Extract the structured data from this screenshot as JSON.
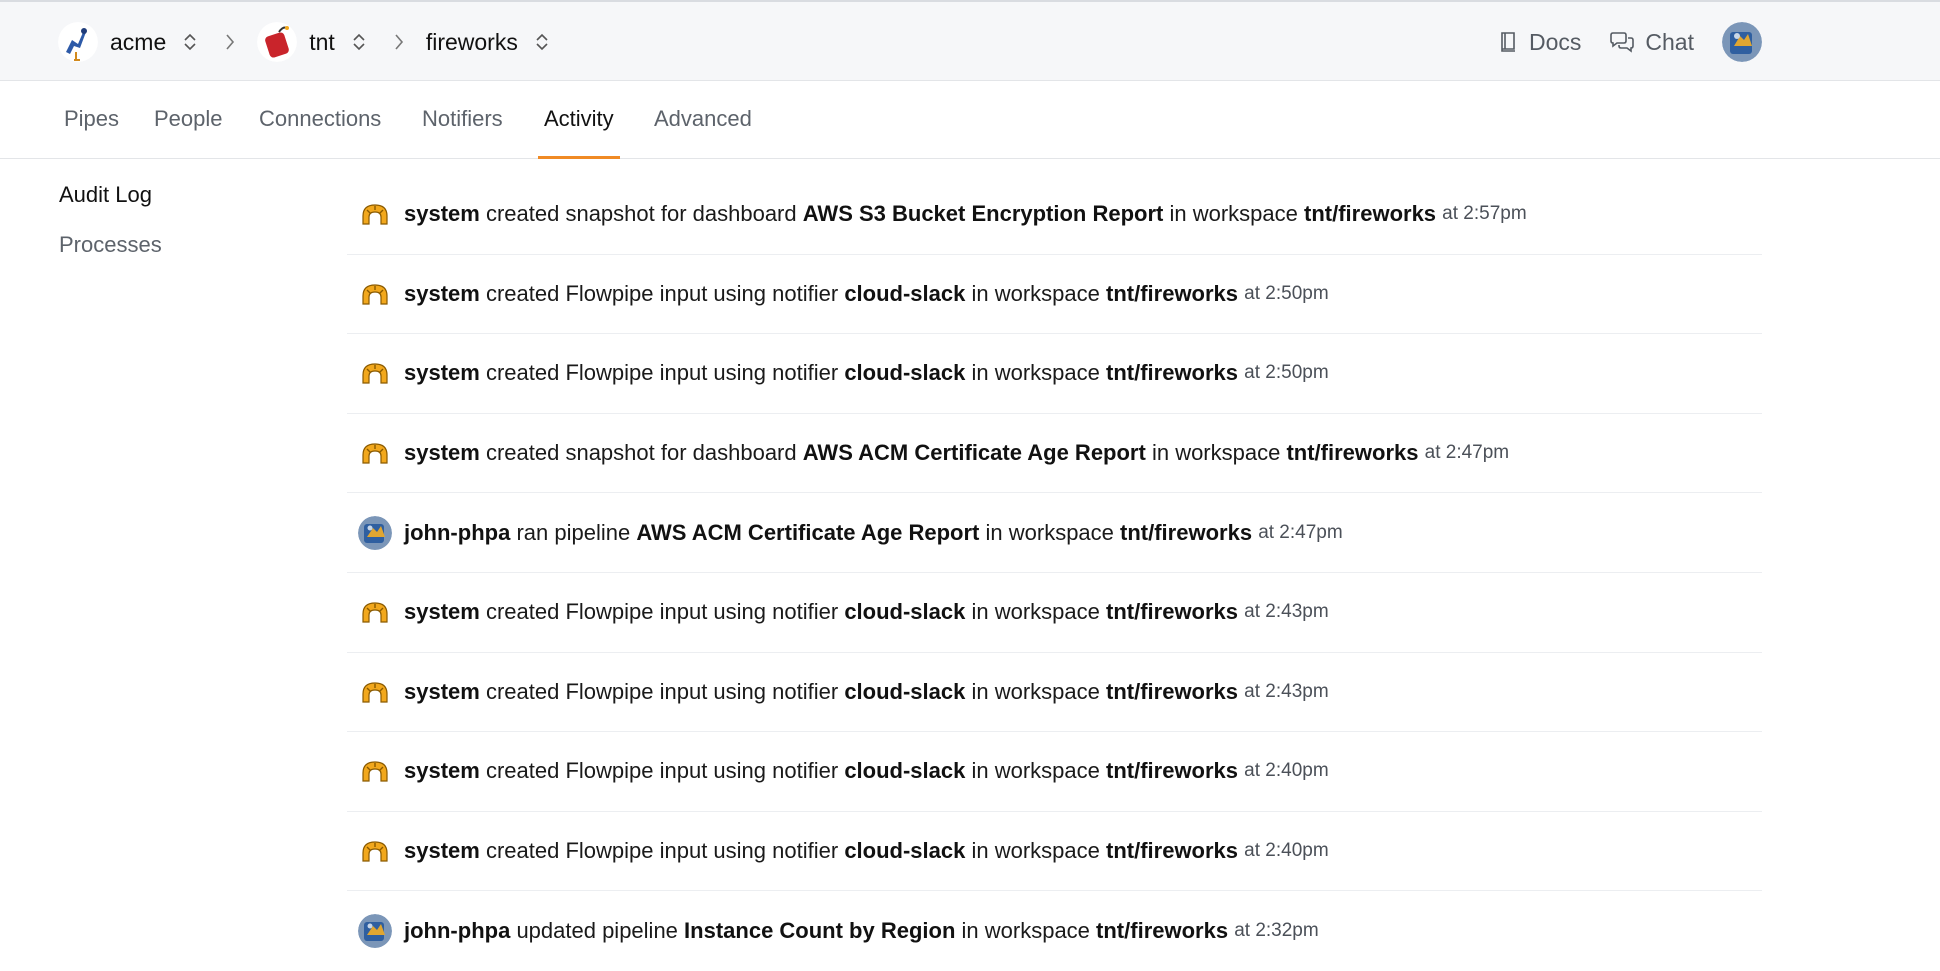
{
  "header": {
    "breadcrumbs": [
      {
        "label": "acme"
      },
      {
        "label": "tnt"
      },
      {
        "label": "fireworks"
      }
    ],
    "links": {
      "docs": "Docs",
      "chat": "Chat"
    }
  },
  "tabs": [
    {
      "label": "Pipes",
      "active": false
    },
    {
      "label": "People",
      "active": false
    },
    {
      "label": "Connections",
      "active": false
    },
    {
      "label": "Notifiers",
      "active": false
    },
    {
      "label": "Activity",
      "active": true
    },
    {
      "label": "Advanced",
      "active": false
    }
  ],
  "sidebar": {
    "items": [
      {
        "label": "Audit Log",
        "active": true
      },
      {
        "label": "Processes",
        "active": false
      }
    ]
  },
  "activity": [
    {
      "actor": "system",
      "avatar": "system-icon",
      "action": "created snapshot for dashboard",
      "target": "AWS S3 Bucket Encryption Report",
      "ws_prefix": "in workspace",
      "workspace": "tnt/fireworks",
      "time": "at 2:57pm"
    },
    {
      "actor": "system",
      "avatar": "system-icon",
      "action": "created Flowpipe input using notifier",
      "target": "cloud-slack",
      "ws_prefix": "in workspace",
      "workspace": "tnt/fireworks",
      "time": "at 2:50pm"
    },
    {
      "actor": "system",
      "avatar": "system-icon",
      "action": "created Flowpipe input using notifier",
      "target": "cloud-slack",
      "ws_prefix": "in workspace",
      "workspace": "tnt/fireworks",
      "time": "at 2:50pm"
    },
    {
      "actor": "system",
      "avatar": "system-icon",
      "action": "created snapshot for dashboard",
      "target": "AWS ACM Certificate Age Report",
      "ws_prefix": "in workspace",
      "workspace": "tnt/fireworks",
      "time": "at 2:47pm"
    },
    {
      "actor": "john-phpa",
      "avatar": "user-avatar",
      "action": "ran pipeline",
      "target": "AWS ACM Certificate Age Report",
      "ws_prefix": "in workspace",
      "workspace": "tnt/fireworks",
      "time": "at 2:47pm"
    },
    {
      "actor": "system",
      "avatar": "system-icon",
      "action": "created Flowpipe input using notifier",
      "target": "cloud-slack",
      "ws_prefix": "in workspace",
      "workspace": "tnt/fireworks",
      "time": "at 2:43pm"
    },
    {
      "actor": "system",
      "avatar": "system-icon",
      "action": "created Flowpipe input using notifier",
      "target": "cloud-slack",
      "ws_prefix": "in workspace",
      "workspace": "tnt/fireworks",
      "time": "at 2:43pm"
    },
    {
      "actor": "system",
      "avatar": "system-icon",
      "action": "created Flowpipe input using notifier",
      "target": "cloud-slack",
      "ws_prefix": "in workspace",
      "workspace": "tnt/fireworks",
      "time": "at 2:40pm"
    },
    {
      "actor": "system",
      "avatar": "system-icon",
      "action": "created Flowpipe input using notifier",
      "target": "cloud-slack",
      "ws_prefix": "in workspace",
      "workspace": "tnt/fireworks",
      "time": "at 2:40pm"
    },
    {
      "actor": "john-phpa",
      "avatar": "user-avatar",
      "action": "updated pipeline",
      "target": "Instance Count by Region",
      "ws_prefix": "in workspace",
      "workspace": "tnt/fireworks",
      "time": "at 2:32pm"
    }
  ],
  "colors": {
    "accent": "#f08a24",
    "system_icon": "#f2a81d",
    "topbar_bg": "#f6f7f9"
  }
}
